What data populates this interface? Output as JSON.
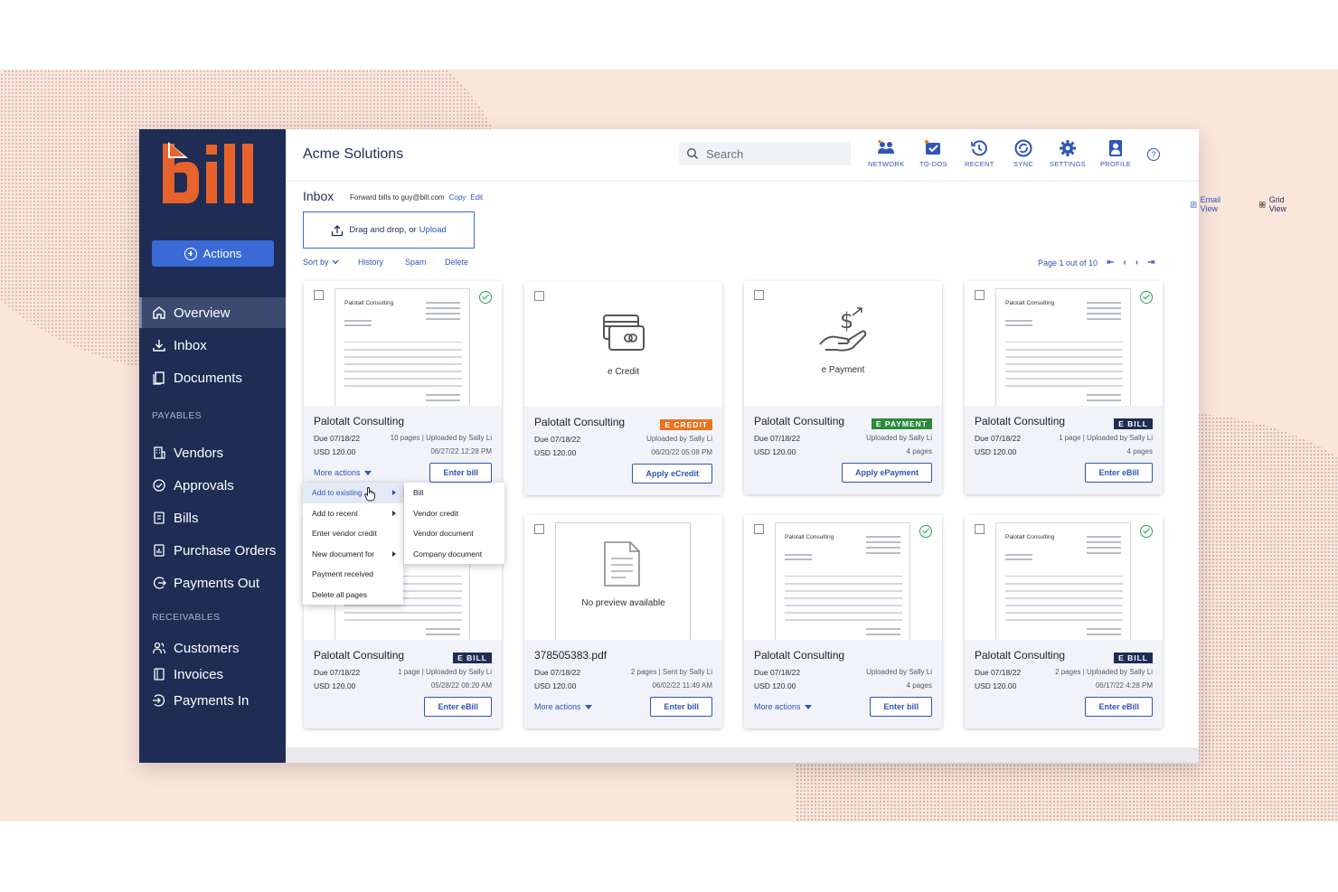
{
  "brand": {
    "logo_text": "bill",
    "logo_color": "#e8622c",
    "sidebar_bg": "#1f2d54",
    "accent": "#3a6ad6"
  },
  "sidebar": {
    "actions_label": "Actions",
    "items": [
      {
        "label": "Overview",
        "icon": "home-icon",
        "active": true
      },
      {
        "label": "Inbox",
        "icon": "inbox-download-icon"
      },
      {
        "label": "Documents",
        "icon": "documents-icon"
      }
    ],
    "payables_label": "PAYABLES",
    "payables": [
      {
        "label": "Vendors",
        "icon": "building-icon"
      },
      {
        "label": "Approvals",
        "icon": "check-circle-icon"
      },
      {
        "label": "Bills",
        "icon": "bill-icon"
      },
      {
        "label": "Purchase Orders",
        "icon": "purchase-order-icon"
      },
      {
        "label": "Payments Out",
        "icon": "payment-out-icon"
      }
    ],
    "receivables_label": "RECEIVABLES",
    "receivables": [
      {
        "label": "Customers",
        "icon": "customers-icon"
      },
      {
        "label": "Invoices",
        "icon": "invoice-icon"
      },
      {
        "label": "Payments In",
        "icon": "payment-in-icon"
      }
    ]
  },
  "header": {
    "company": "Acme Solutions",
    "search_placeholder": "Search",
    "icons": [
      {
        "label": "NETWORK",
        "icon": "network-icon"
      },
      {
        "label": "TO-DOS",
        "icon": "todos-icon"
      },
      {
        "label": "RECENT",
        "icon": "recent-icon"
      },
      {
        "label": "SYNC",
        "icon": "sync-icon"
      },
      {
        "label": "SETTINGS",
        "icon": "gear-icon"
      },
      {
        "label": "PROFILE",
        "icon": "profile-icon"
      }
    ],
    "help": "?"
  },
  "inbox": {
    "title": "Inbox",
    "forward_text": "Forward bills to guy@bill.com",
    "copy": "Copy",
    "edit": "Edit",
    "email_view": "Email View",
    "grid_view": "Grid View",
    "upload_text": "Drag and drop, or",
    "upload_link": "Upload",
    "sort_by": "Sort by",
    "history": "History",
    "spam": "Spam",
    "delete": "Delete",
    "page_text": "Page 1 out of 10"
  },
  "cards": [
    {
      "vendor": "Palotalt Consulting",
      "due": "Due 07/18/22",
      "amount": "USD 120.00",
      "meta1": "10 pages  |  Uploaded by Sally Li",
      "meta2": "06/27/22    12:28 PM",
      "badge": "",
      "more_actions": "More actions",
      "button": "Enter bill",
      "thumb_title": "Palotalt Consulting"
    },
    {
      "vendor": "Palotalt Consulting",
      "due": "Due 07/18/22",
      "amount": "USD 120.00",
      "meta1": "Uploaded by Sally Li",
      "meta2": "06/20/22    05:08 PM",
      "badge": "E CREDIT",
      "badge_color": "#e8731f",
      "button": "Apply eCredit",
      "preview_label": "e Credit"
    },
    {
      "vendor": "Palotalt Consulting",
      "due": "Due 07/18/22",
      "amount": "USD 120.00",
      "meta1": "Uploaded by Sally Li",
      "meta2": "4 pages",
      "badge": "E PAYMENT",
      "badge_color": "#2b8a3e",
      "button": "Apply ePayment",
      "preview_label": "e Payment"
    },
    {
      "vendor": "Palotalt Consulting",
      "due": "Due 07/18/22",
      "amount": "USD 120.00",
      "meta1": "1 page  |  Uploaded by Sally Li",
      "meta2": "4 pages",
      "badge": "E BILL",
      "badge_color": "#1f2d54",
      "button": "Enter eBill",
      "thumb_title": "Palotalt Consulting"
    },
    {
      "vendor": "Palotalt Consulting",
      "due": "Due 07/18/22",
      "amount": "USD 120.00",
      "meta1": "1 page  |  Uploaded by Sally Li",
      "meta2": "05/28/22    08:20 AM",
      "badge": "E BILL",
      "badge_color": "#1f2d54",
      "button": "Enter eBill"
    },
    {
      "vendor": "378505383.pdf",
      "due": "Due 07/18/22",
      "amount": "USD 120.00",
      "meta1": "2 pages  |  Sent by Sally Li",
      "meta2": "06/02/22    11:49 AM",
      "badge": "",
      "more_actions": "More actions",
      "button": "Enter bill",
      "preview_label": "No preview available"
    },
    {
      "vendor": "Palotalt Consulting",
      "due": "Due 07/18/22",
      "amount": "USD 120.00",
      "meta1": "Uploaded by Sally Li",
      "meta2": "4 pages",
      "badge": "",
      "more_actions": "More actions",
      "button": "Enter bill",
      "thumb_title": "Palotalt Consulting"
    },
    {
      "vendor": "Palotalt Consulting",
      "due": "Due 07/18/22",
      "amount": "USD 120.00",
      "meta1": "2 pages  |  Uploaded by Sally Li",
      "meta2": "06/17/22    4:28 PM",
      "badge": "E BILL",
      "badge_color": "#1f2d54",
      "button": "Enter eBill",
      "thumb_title": "Palotalt Consulting"
    }
  ],
  "menu": {
    "items": [
      "Add to existing",
      "Add to recent",
      "Enter vendor credit",
      "New document for",
      "Payment received",
      "Delete all pages"
    ],
    "submenu": [
      "Bill",
      "Vendor credit",
      "Vendor document",
      "Company document"
    ]
  }
}
